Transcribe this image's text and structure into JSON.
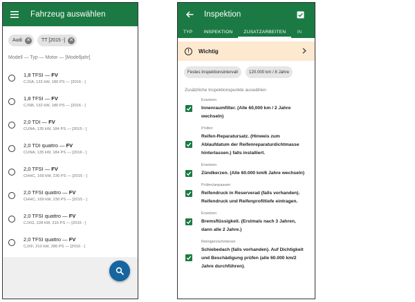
{
  "left": {
    "title": "Fahrzeug auswählen",
    "menu_icon": "menu-icon",
    "chips": [
      {
        "label": "Audi"
      },
      {
        "label": "TT [2015 -]"
      }
    ],
    "list_header": "Modell — Typ — Motor — [Modelljahr]",
    "vehicles": [
      {
        "model": "1,8 TFSI",
        "suffix": "FV",
        "details": "CJSA, 132 kW, 180 PS — [2016 - ]"
      },
      {
        "model": "1,8 TFSI",
        "suffix": "FV",
        "details": "CJSB, 132 kW, 180 PS — [2016 - ]"
      },
      {
        "model": "2,0 TDI",
        "suffix": "FV",
        "details": "CUNA, 135 kW, 184 PS — [2015 - ]"
      },
      {
        "model": "2,0 TDI quattro",
        "suffix": "FV",
        "details": "CUNA, 135 kW, 184 PS — [2016 - ]"
      },
      {
        "model": "2,0 TFSI",
        "suffix": "FV",
        "details": "CHHC, 169 kW, 230 PS — [2015 - ]"
      },
      {
        "model": "2,0 TFSI quattro",
        "suffix": "FV",
        "details": "CHHC, 169 kW, 230 PS — [2015 - ]"
      },
      {
        "model": "2,0 TFSI quattro",
        "suffix": "FV",
        "details": "CJXG, 228 kW, 310 PS — [2015 - ]"
      },
      {
        "model": "2,0 TFSI quattro",
        "suffix": "FV",
        "details": "CJXF, 210 kW, 286 PS — [2016 - ]"
      }
    ],
    "fab_icon": "search-icon"
  },
  "right": {
    "title": "Inspektion",
    "back_icon": "arrow-back-icon",
    "action_icon": "checklist-icon",
    "tabs": [
      {
        "label": "TYP"
      },
      {
        "label": "INSPEKTION"
      },
      {
        "label": "ZUSATZARBEITEN"
      },
      {
        "label": "IN"
      }
    ],
    "active_tab": "ZUSATZARBEITEN",
    "warning": {
      "label": "Wichtig",
      "icon": "exclamation-circle-icon"
    },
    "chips": [
      {
        "label": "Festes Inspektionsintervall"
      },
      {
        "label": "120.000 km / 8 Jahre"
      }
    ],
    "subheader": "Zusätzliche Inspektionspunkte auswählen",
    "items": [
      {
        "category": "Ersetzen",
        "text": "Innenraumfilter. (Alle 60,000 km / 2 Jahre wechseln)",
        "checked": true
      },
      {
        "category": "Prüfen",
        "text": "Reifen-Reparatursatz. (Hinweis zum Ablaufdatum der Reifenreparaturdichtmasse hinterlassen.) falls installiert.",
        "checked": true
      },
      {
        "category": "Ersetzen",
        "text": "Zündkerzen. (Alle 60.000 km/6 Jahre wechseln)",
        "checked": true
      },
      {
        "category": "Prüfen/anpassen",
        "text": "Reifendruck in Reserverad (falls vorhanden). Reifendruck und Reifenprofiltiefe eintragen.",
        "checked": true
      },
      {
        "category": "Ersetzen",
        "text": "Bremsflüssigkeit. (Erstmals nach 3 Jahren, dann alle 2 Jahre.)",
        "checked": true
      },
      {
        "category": "Reinigen/schmieren",
        "text": "Schiebedach (falls vorhanden). Auf Dichtigkeit und Beschädigung prüfen (alle 60.000 km/2 Jahre durchführen).",
        "checked": true
      }
    ]
  },
  "colors": {
    "primary": "#1b7a43",
    "fab": "#1565a0",
    "warning_bg": "#fde9cf"
  }
}
